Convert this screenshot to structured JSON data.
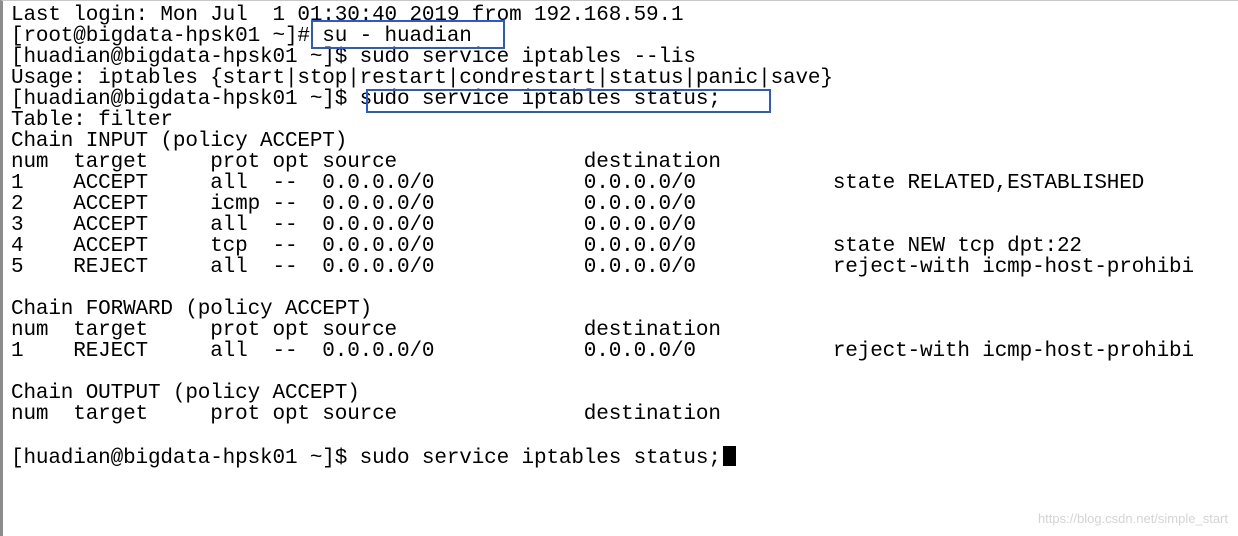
{
  "terminal": {
    "lines": [
      "Last login: Mon Jul  1 01:30:40 2019 from 192.168.59.1",
      "[root@bigdata-hpsk01 ~]# su - huadian",
      "[huadian@bigdata-hpsk01 ~]$ sudo service iptables --lis",
      "Usage: iptables {start|stop|restart|condrestart|status|panic|save}",
      "[huadian@bigdata-hpsk01 ~]$ sudo service iptables status;",
      "Table: filter",
      "Chain INPUT (policy ACCEPT)",
      "num  target     prot opt source               destination",
      "1    ACCEPT     all  --  0.0.0.0/0            0.0.0.0/0           state RELATED,ESTABLISHED",
      "2    ACCEPT     icmp --  0.0.0.0/0            0.0.0.0/0",
      "3    ACCEPT     all  --  0.0.0.0/0            0.0.0.0/0",
      "4    ACCEPT     tcp  --  0.0.0.0/0            0.0.0.0/0           state NEW tcp dpt:22",
      "5    REJECT     all  --  0.0.0.0/0            0.0.0.0/0           reject-with icmp-host-prohibi",
      "",
      "Chain FORWARD (policy ACCEPT)",
      "num  target     prot opt source               destination",
      "1    REJECT     all  --  0.0.0.0/0            0.0.0.0/0           reject-with icmp-host-prohibi",
      "",
      "Chain OUTPUT (policy ACCEPT)",
      "num  target     prot opt source               destination",
      "",
      "[huadian@bigdata-hpsk01 ~]$ sudo service iptables status;"
    ]
  },
  "watermark": "https://blog.csdn.net/simple_start",
  "colors": {
    "background": "#ffffff",
    "text": "#000000",
    "highlight_border": "#2f59c8",
    "watermark": "#d4d4d4"
  }
}
